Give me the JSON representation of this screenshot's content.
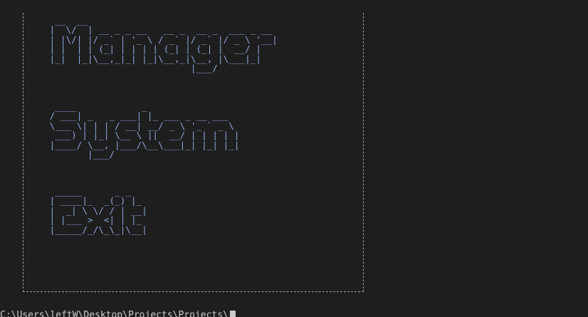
{
  "terminal": {
    "background": "#1e1e1e",
    "text_color": "#cccccc",
    "art_color": "#8ea6da",
    "border_color": "#9a9a9a"
  },
  "menu": {
    "manager_art": "  __  __\n |  \\/  | __ _ _ __   __ _  __ _  ___ _ __\n | |\\/| |/ _` | '_ \\ / _` |/ _` |/ _ \\ '__|\n | |  | | (_| | | | | (_| | (_| |  __/ |\n |_|  |_|\\__,_|_| |_|\\__,_|\\__, |\\___|_|\n                           |___/",
    "system_art": "  ____            _\n / ___| _   _ ___| |_ ___ _ __ ___\n \\___ \\| | | / __| __/ _ \\ '_ ` _ \\\n  ___) | |_| \\__ \\ ||  __/ | | | | |\n |____/ \\__, |___/\\__\\___|_| |_| |_|\n        |___/",
    "exit_art": "  _____      _ _\n | ____|_  _(_) |_\n |  _| \\ \\/ / | __|\n | |___ >  <| | |_\n |_____/_/\\_\\_|\\__|"
  },
  "prompt": {
    "text": "C:\\Users\\leftW\\Desktop\\Projects\\Projects\\"
  }
}
